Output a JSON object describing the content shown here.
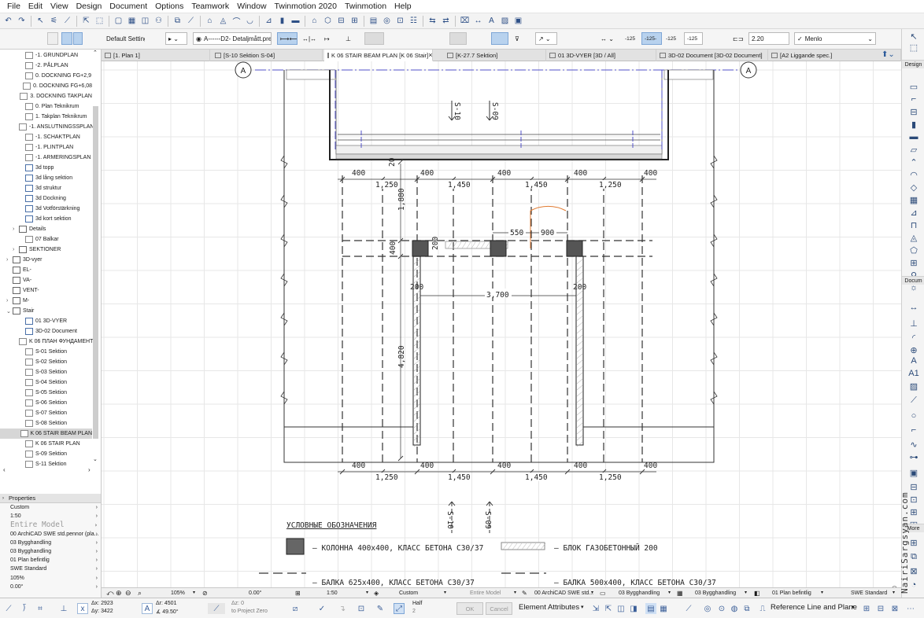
{
  "menu": [
    "File",
    "Edit",
    "View",
    "Design",
    "Document",
    "Options",
    "Teamwork",
    "Window",
    "Twinmotion 2020",
    "Twinmotion",
    "Help"
  ],
  "infobox": {
    "default_settings": "Default Settings",
    "pen_set": "A------D2- Detaljmått.pres",
    "scale_values": [
      "-125",
      "-125-",
      "-125",
      "-125"
    ],
    "height_value": "2.20",
    "font_name": "Menlo"
  },
  "tabs": [
    {
      "label": "[1. Plan 1]"
    },
    {
      "label": "[S-10 Sektion S-04]"
    },
    {
      "label": "K 06 STAIR BEAM PLAN [K 06 Stair]",
      "active": true,
      "close": "×"
    },
    {
      "label": "[K-27.7 Sektion]"
    },
    {
      "label": "01 3D-VYER [3D / All]"
    },
    {
      "label": "3D-02 Document [3D-02 Document]"
    },
    {
      "label": "[A2 Liggande spec.]"
    }
  ],
  "navigator": {
    "items": [
      {
        "label": "-1. GRUNDPLAN",
        "indent": 2,
        "type": "plan"
      },
      {
        "label": "-2. PÅLPLAN",
        "indent": 2,
        "type": "plan"
      },
      {
        "label": "0. DOCKNING FG+2,9",
        "indent": 2,
        "type": "plan"
      },
      {
        "label": "0. DOCKNING FG+6,08",
        "indent": 2,
        "type": "plan"
      },
      {
        "label": "3. DOCKNING TAKPLAN",
        "indent": 2,
        "type": "plan"
      },
      {
        "label": "0. Plan Teknikrum",
        "indent": 2,
        "type": "plan"
      },
      {
        "label": "1. Takplan Teknikrum",
        "indent": 2,
        "type": "plan"
      },
      {
        "label": "-1. ANSLUTNINGSSPLAN",
        "indent": 2,
        "type": "plan"
      },
      {
        "label": "-1. SCHAKTPLAN",
        "indent": 2,
        "type": "plan"
      },
      {
        "label": "-1. PLINTPLAN",
        "indent": 2,
        "type": "plan"
      },
      {
        "label": "-1. ARMERINGSPLAN",
        "indent": 2,
        "type": "plan"
      },
      {
        "label": "3d topp",
        "indent": 2,
        "type": "3d"
      },
      {
        "label": "3d lång sektion",
        "indent": 2,
        "type": "3d"
      },
      {
        "label": "3d struktur",
        "indent": 2,
        "type": "3d"
      },
      {
        "label": "3d Dockning",
        "indent": 2,
        "type": "3d"
      },
      {
        "label": "3d Votförstärkning",
        "indent": 2,
        "type": "3d"
      },
      {
        "label": "3d kort sektion",
        "indent": 2,
        "type": "3d"
      },
      {
        "label": "Details",
        "indent": 1,
        "type": "folder",
        "twisty": "›"
      },
      {
        "label": "07 Balkar",
        "indent": 2,
        "type": "plan"
      },
      {
        "label": "SEKTIONER",
        "indent": 1,
        "type": "folder",
        "twisty": "›"
      },
      {
        "label": "3D-vyer",
        "indent": 0,
        "type": "folder",
        "twisty": "›"
      },
      {
        "label": "EL-",
        "indent": 0,
        "type": "folder"
      },
      {
        "label": "VA-",
        "indent": 0,
        "type": "folder"
      },
      {
        "label": "VENT-",
        "indent": 0,
        "type": "folder"
      },
      {
        "label": "M-",
        "indent": 0,
        "type": "folder",
        "twisty": "›"
      },
      {
        "label": "Stair",
        "indent": 0,
        "type": "folder",
        "twisty": "⌄"
      },
      {
        "label": "01 3D-VYER",
        "indent": 2,
        "type": "3d"
      },
      {
        "label": "3D-02 Document",
        "indent": 2,
        "type": "3d"
      },
      {
        "label": "K 06 ПЛАН ФУНДАМЕНТ",
        "indent": 2,
        "type": "plan"
      },
      {
        "label": "S-01 Sektion",
        "indent": 2,
        "type": "plan"
      },
      {
        "label": "S-02 Sektion",
        "indent": 2,
        "type": "plan"
      },
      {
        "label": "S-03 Sektion",
        "indent": 2,
        "type": "plan"
      },
      {
        "label": "S-04 Sektion",
        "indent": 2,
        "type": "plan"
      },
      {
        "label": "S-05 Sektion",
        "indent": 2,
        "type": "plan"
      },
      {
        "label": "S-06 Sektion",
        "indent": 2,
        "type": "plan"
      },
      {
        "label": "S-07 Sektion",
        "indent": 2,
        "type": "plan"
      },
      {
        "label": "S-08 Sektion",
        "indent": 2,
        "type": "plan"
      },
      {
        "label": "K 06 STAIR BEAM PLAN",
        "indent": 2,
        "type": "plan",
        "selected": true
      },
      {
        "label": "K 06 STAIR PLAN",
        "indent": 2,
        "type": "plan"
      },
      {
        "label": "S-09 Sektion",
        "indent": 2,
        "type": "plan"
      },
      {
        "label": "S-11 Sektion",
        "indent": 2,
        "type": "plan"
      }
    ]
  },
  "properties": {
    "header": "Properties",
    "rows": [
      {
        "label": "Custom"
      },
      {
        "label": "1:50"
      },
      {
        "label": "Entire Model",
        "dim": true
      },
      {
        "label": "00 ArchiCAD SWE std.pennor (pla..."
      },
      {
        "label": "03 Bygghandling"
      },
      {
        "label": "03 Bygghandling"
      },
      {
        "label": "01 Plan befintlig"
      },
      {
        "label": "SWE Standard"
      },
      {
        "label": "105%"
      },
      {
        "label": "0.00°"
      }
    ]
  },
  "drawing": {
    "grid_label": "A",
    "section_markers": [
      "S-10",
      "S-09"
    ],
    "dims": {
      "col_width": "400",
      "spans": [
        "1,250",
        "1,450",
        "1,450",
        "1,250"
      ],
      "v1": "1,880",
      "v2": "4,820",
      "beam_h": "400",
      "small": "200",
      "door_550": "550",
      "door_900": "900",
      "inner": "3,700",
      "top20": "20"
    },
    "legend": {
      "title": "УСЛОВНЫЕ ОБОЗНАЧЕНИЯ",
      "column": "– КОЛОННА 400х400, КЛАСС БЕТОНА С30/37",
      "block": "– БЛОК ГАЗОБЕТОННЫЙ 200",
      "beam1": "– БАЛКА 625х400, КЛАСС БЕТОНА С30/37",
      "beam2": "– БАЛКА 500х400, КЛАСС БЕТОНА С30/37"
    }
  },
  "right_panel": {
    "design": "Design",
    "document": "Docum",
    "more": "More"
  },
  "statusbar": {
    "zoom": "105%",
    "angle": "0.00°",
    "scale": "1:50",
    "custom": "Custom",
    "model": "Entire Model",
    "pens": "00 ArchiCAD SWE std...",
    "layer1": "03 Bygghandling",
    "layer2": "03 Bygghandling",
    "renov": "01 Plan befintlig",
    "std": "SWE Standard"
  },
  "coords": {
    "dx": "Δx: 2923",
    "dy": "Δy: 3422",
    "ar": "Δr: 4501",
    "aa": "∡ 49.50°",
    "az": "Δz: 0",
    "zref": "to Project Zero",
    "half": "Half",
    "half_n": "2",
    "ok": "OK",
    "cancel": "Cancel",
    "element_attributes": "Element Attributes",
    "ref_line": "Reference Line and Plane"
  },
  "watermark": "© NairiSargsyan.com"
}
